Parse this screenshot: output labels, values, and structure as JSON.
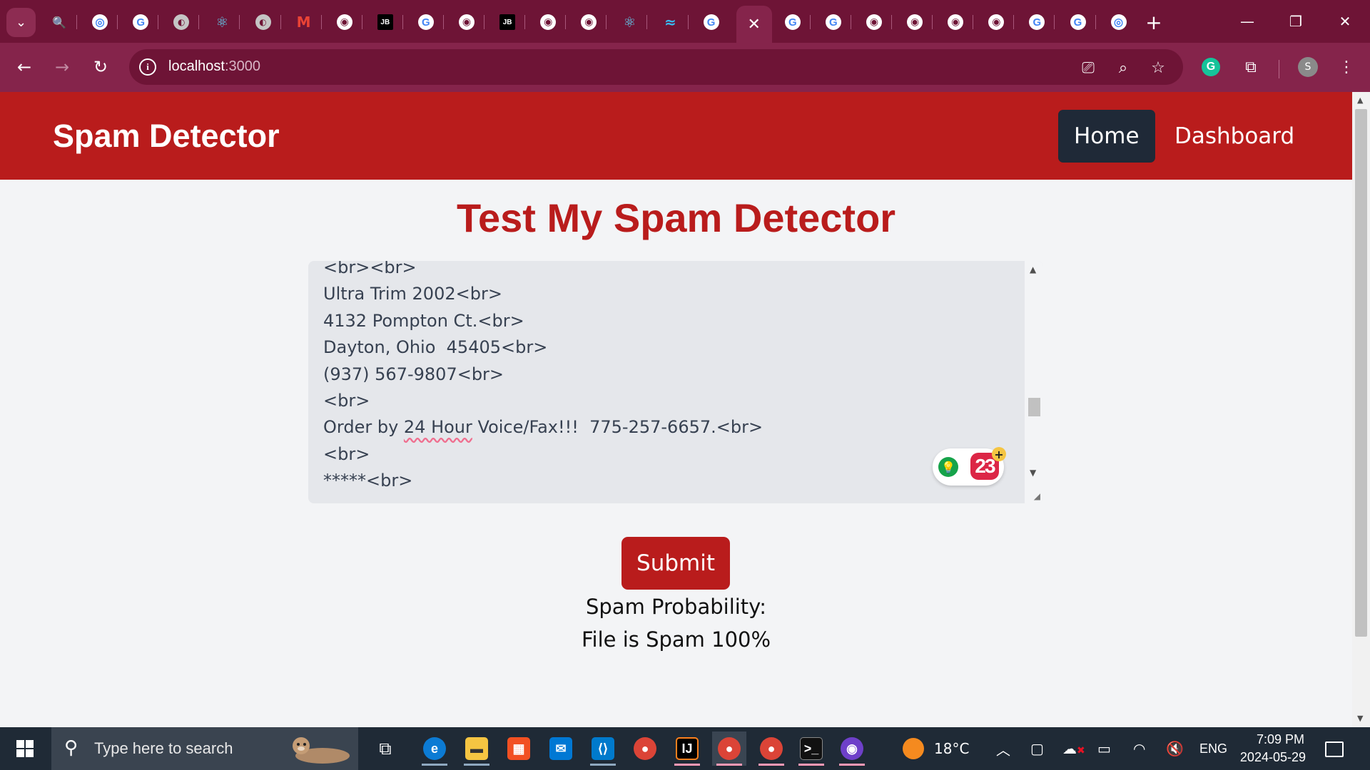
{
  "browser": {
    "url_host": "localhost",
    "url_port": ":3000",
    "accent_color": "#85244b",
    "tabs": [
      {
        "icon": "search-icon"
      },
      {
        "icon": "chrome-icon"
      },
      {
        "icon": "google-icon"
      },
      {
        "icon": "globe-icon"
      },
      {
        "icon": "react-icon"
      },
      {
        "icon": "globe-icon"
      },
      {
        "icon": "gmail-icon"
      },
      {
        "icon": "github-icon"
      },
      {
        "icon": "jetbrains-icon"
      },
      {
        "icon": "google-icon"
      },
      {
        "icon": "github-icon"
      },
      {
        "icon": "jetbrains-icon"
      },
      {
        "icon": "github-icon"
      },
      {
        "icon": "github-icon"
      },
      {
        "icon": "react-icon"
      },
      {
        "icon": "tailwind-icon"
      },
      {
        "icon": "google-icon"
      },
      {
        "icon": "close-icon",
        "active": true
      },
      {
        "icon": "google-icon"
      },
      {
        "icon": "google-icon"
      },
      {
        "icon": "github-icon"
      },
      {
        "icon": "github-icon"
      },
      {
        "icon": "github-icon"
      },
      {
        "icon": "github-icon"
      },
      {
        "icon": "google-icon"
      },
      {
        "icon": "google-icon"
      },
      {
        "icon": "chrome-icon"
      }
    ],
    "profile_initial": "S"
  },
  "app": {
    "brand": "Spam Detector",
    "nav": {
      "home": "Home",
      "dashboard": "Dashboard"
    },
    "title": "Test My Spam Detector",
    "textarea_lines": [
      "<br><br>",
      "Ultra Trim 2002<br>",
      "4132 Pompton Ct.<br>",
      "Dayton, Ohio  45405<br>",
      "(937) 567-9807<br>",
      "<br>",
      "Order by 24 Hour Voice/Fax!!!  775-257-6657.<br>",
      "<br>",
      "*****<br>"
    ],
    "grammarly_count": "23",
    "submit_label": "Submit",
    "probability_label": "Spam Probability:",
    "result": "File is Spam 100%",
    "brand_color": "#b91c1c",
    "active_nav_color": "#1f2937"
  },
  "taskbar": {
    "search_placeholder": "Type here to search",
    "weather": "18°C",
    "language": "ENG",
    "time": "7:09 PM",
    "date": "2024-05-29"
  }
}
